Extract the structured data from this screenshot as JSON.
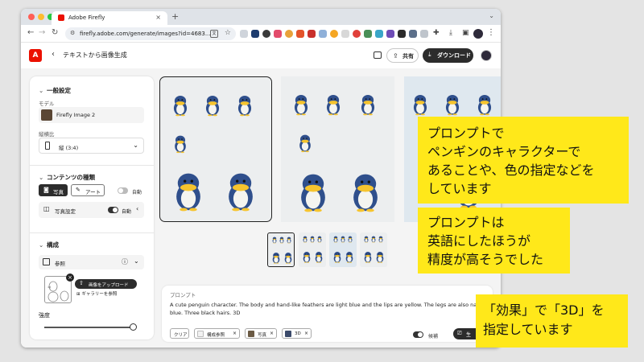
{
  "browser": {
    "tab_title": "Adobe Firefly",
    "url": "firefly.adobe.com/generate/images?id=4683...",
    "dot_colors": [
      "#ff5f57",
      "#febc2e",
      "#28c840"
    ]
  },
  "app": {
    "logo": "A",
    "page_title": "テキストから画像生成",
    "share_label": "共有",
    "download_label": "ダウンロード"
  },
  "panel": {
    "general_title": "一般設定",
    "model_label": "モデル",
    "model_value": "Firefly Image 2",
    "aspect_label": "縦横比",
    "aspect_value": "縦 (3:4)",
    "content_type_title": "コンテンツの種類",
    "content_type_photo": "写真",
    "content_type_art": "アート",
    "auto_label": "自動",
    "photo_settings_label": "写真設定",
    "photo_settings_auto": "自動",
    "composition_title": "構成",
    "reference_label": "参照",
    "upload_label": "画像をアップロード",
    "gallery_label": "ギャラリーを参照",
    "strength_label": "強度",
    "strength_value": 1.0
  },
  "prompt": {
    "header": "プロンプト",
    "text": "A cute penguin character. The body and hand-like feathers are light blue and the lips are yellow. The legs are also navy blue. Three black hairs. 3D",
    "clear_label": "クリア",
    "chips": [
      {
        "label": "構成参照",
        "swatch": "#f2f2f2"
      },
      {
        "label": "写真",
        "swatch": "#6b5a44"
      },
      {
        "label": "3D",
        "swatch": "#3b4a6b"
      }
    ],
    "variation_label": "候補",
    "generate_label": "生"
  },
  "annotations": [
    {
      "lines": [
        "プロンプトで",
        "ペンギンのキャラクターで",
        "あることや、色の指定などを",
        "しています"
      ]
    },
    {
      "lines": [
        "プロンプトは",
        "英語にしたほうが",
        "精度が高そうでした"
      ]
    },
    {
      "lines": [
        "「効果」で「3D」を",
        "指定しています"
      ]
    }
  ],
  "colors": {
    "accent": "#eb1000",
    "annotation_bg": "#ffe81a",
    "penguin_body": "#2f4f8c",
    "penguin_beak": "#f6c42e",
    "penguin_belly": "#f4f4f0"
  }
}
